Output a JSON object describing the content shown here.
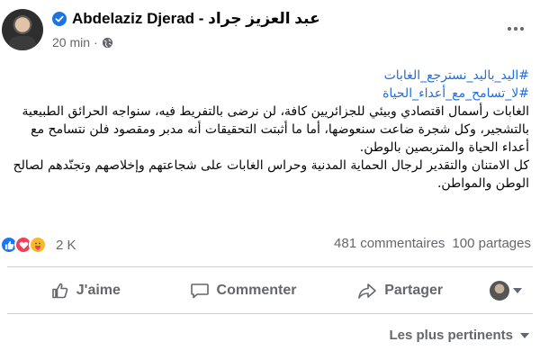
{
  "post": {
    "author": "Abdelaziz Djerad - عبد العزيز جراد",
    "time": "20 min",
    "time_separator": "·",
    "hashtags": [
      "#اليد_باليد_نسترجع_الغابات",
      "#لا_تسامح_مع_أعداء_الحياة"
    ],
    "paragraphs": [
      "الغابات رأسمال اقتصادي وبيئي للجزائريين كافة، لن نرضى بالتفريط فيه، سنواجه الحرائق الطبيعية بالتشجير، وكل شجرة ضاعت سنعوضها، أما ما أثبتت التحقيقات أنه مدبر ومقصود فلن نتسامح مع أعداء الحياة والمتربصين بالوطن.",
      "كل الامتنان والتقدير لرجال الحماية المدنية وحراس الغابات على شجاعتهم وإخلاصهم وتجنّدهم لصالح الوطن والمواطن."
    ],
    "reaction_count": "2 K",
    "comments": "481 commentaires",
    "shares": "100 partages"
  },
  "actions": {
    "like": "J'aime",
    "comment": "Commenter",
    "share": "Partager"
  },
  "sort": {
    "label": "Les plus pertinents"
  },
  "icons": {
    "verified": "verified-badge-icon",
    "globe": "globe-icon",
    "more": "more-options-icon",
    "like": "thumbs-up-icon",
    "comment": "comment-bubble-icon",
    "share": "share-arrow-icon"
  },
  "colors": {
    "accent": "#1877f2",
    "hashtag": "#216fdb",
    "muted": "#65676b"
  }
}
